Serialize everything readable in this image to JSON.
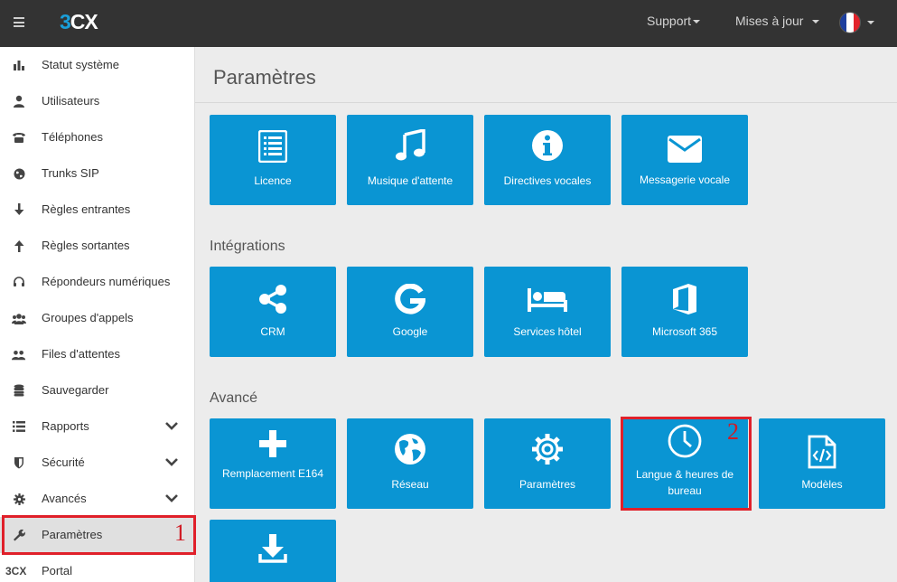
{
  "header": {
    "logo_three": "3",
    "logo_cx": "CX",
    "support_label": "Support",
    "updates_label": "Mises à jour"
  },
  "sidebar": {
    "items": [
      {
        "label": "Statut système",
        "icon": "bar-chart-icon"
      },
      {
        "label": "Utilisateurs",
        "icon": "user-icon"
      },
      {
        "label": "Téléphones",
        "icon": "phone-icon"
      },
      {
        "label": "Trunks SIP",
        "icon": "globe-icon"
      },
      {
        "label": "Règles entrantes",
        "icon": "arrow-down-icon"
      },
      {
        "label": "Règles sortantes",
        "icon": "arrow-up-icon"
      },
      {
        "label": "Répondeurs numériques",
        "icon": "headset-icon"
      },
      {
        "label": "Groupes d'appels",
        "icon": "group-icon"
      },
      {
        "label": "Files d'attentes",
        "icon": "users-icon"
      },
      {
        "label": "Sauvegarder",
        "icon": "database-icon"
      },
      {
        "label": "Rapports",
        "icon": "list-icon"
      },
      {
        "label": "Sécurité",
        "icon": "shield-icon"
      },
      {
        "label": "Avancés",
        "icon": "gear-icon"
      },
      {
        "label": "Paramètres",
        "icon": "wrench-icon"
      },
      {
        "label": "Portal",
        "icon": "3cx-icon"
      }
    ],
    "portal_icon_text": "3CX"
  },
  "main": {
    "title": "Paramètres",
    "tiles_general": [
      {
        "label": "Licence",
        "icon": "license-list-icon"
      },
      {
        "label": "Musique d'attente",
        "icon": "music-icon"
      },
      {
        "label": "Directives vocales",
        "icon": "info-icon"
      },
      {
        "label": "Messagerie vocale",
        "icon": "envelope-icon"
      }
    ],
    "integrations_title": "Intégrations",
    "tiles_integrations": [
      {
        "label": "CRM",
        "icon": "share-icon"
      },
      {
        "label": "Google",
        "icon": "google-icon"
      },
      {
        "label": "Services hôtel",
        "icon": "bed-icon"
      },
      {
        "label": "Microsoft 365",
        "icon": "office-icon"
      }
    ],
    "advanced_title": "Avancé",
    "tiles_advanced": [
      {
        "label": "Remplacement E164",
        "icon": "plus-icon"
      },
      {
        "label": "Réseau",
        "icon": "earth-icon"
      },
      {
        "label": "Paramètres",
        "icon": "cog-icon"
      },
      {
        "label": "Langue & heures de bureau",
        "icon": "clock-icon"
      },
      {
        "label": "Modèles",
        "icon": "code-file-icon"
      }
    ],
    "tiles_extra": [
      {
        "label": "",
        "icon": "download-icon"
      }
    ]
  },
  "annotations": {
    "marker_one": "1",
    "marker_two": "2",
    "color": "#e0202a"
  },
  "colors": {
    "topbar": "#333333",
    "tile": "#0a95d3",
    "brand_blue": "#1a9fd9"
  }
}
